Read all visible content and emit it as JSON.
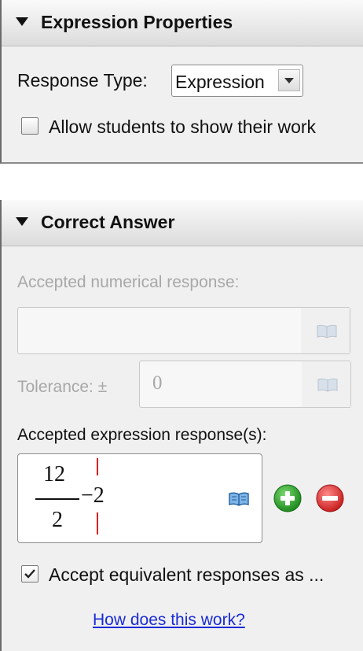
{
  "expression_properties": {
    "title": "Expression Properties",
    "response_type_label": "Response Type:",
    "response_type_value": "Expression",
    "show_work_label": "Allow students to show their work",
    "show_work_checked": false
  },
  "correct_answer": {
    "title": "Correct Answer",
    "numerical_label": "Accepted numerical response:",
    "numerical_value": "",
    "tolerance_label": "Tolerance: ±",
    "tolerance_value": "0",
    "expression_label": "Accepted expression response(s):",
    "expression": {
      "numerator": "12",
      "denominator": "2",
      "rest": "−2"
    },
    "equivalent_label": "Accept equivalent responses as ...",
    "equivalent_checked": true,
    "help_link": "How does this work?"
  },
  "colors": {
    "add_button": "#2aa02a",
    "remove_button": "#d42a2a",
    "cursor": "#e02020",
    "link": "#1a2bd6"
  }
}
